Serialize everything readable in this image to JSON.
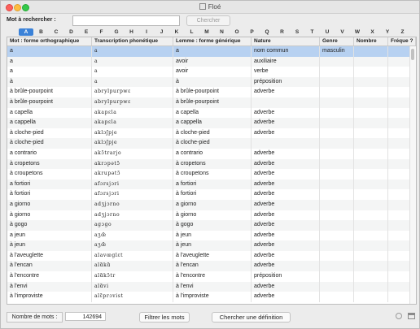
{
  "window": {
    "title": "Floé"
  },
  "search": {
    "label": "Mot à rechercher :",
    "value": "",
    "button": "Chercher"
  },
  "alphabet": [
    "A",
    "B",
    "C",
    "D",
    "E",
    "F",
    "G",
    "H",
    "I",
    "J",
    "K",
    "L",
    "M",
    "N",
    "O",
    "P",
    "Q",
    "R",
    "S",
    "T",
    "U",
    "V",
    "W",
    "X",
    "Y",
    "Z"
  ],
  "alphabet_active": "A",
  "table": {
    "columns": [
      "Mot : forme orthographique",
      "Transcription phonétique",
      "Lemme : forme générique",
      "Nature",
      "Genre",
      "Nombre",
      "Fréque ?"
    ],
    "selected_row": 0,
    "rows": [
      [
        "a",
        "a",
        "a",
        "nom commun",
        "masculin",
        "",
        ""
      ],
      [
        "a",
        "a",
        "avoir",
        "auxiliaire",
        "",
        "",
        ""
      ],
      [
        "a",
        "a",
        "avoir",
        "verbe",
        "",
        "",
        ""
      ],
      [
        "à",
        "a",
        "à",
        "préposition",
        "",
        "",
        ""
      ],
      [
        "à brûle-pourpoint",
        "abrylpurpwɛ",
        "à brûle-pourpoint",
        "adverbe",
        "",
        "",
        ""
      ],
      [
        "à brûle-pourpoint",
        "abrylpurpwɛ",
        "à brûle-pourpoint",
        "",
        "",
        "",
        ""
      ],
      [
        "a capella",
        "akapɛla",
        "a capella",
        "adverbe",
        "",
        "",
        ""
      ],
      [
        "a cappella",
        "akapɛla",
        "a cappella",
        "adverbe",
        "",
        "",
        ""
      ],
      [
        "à cloche-pied",
        "aklɔʃpje",
        "à cloche-pied",
        "adverbe",
        "",
        "",
        ""
      ],
      [
        "à cloche-pied",
        "aklɔʃpje",
        "à cloche-pied",
        "",
        "",
        "",
        ""
      ],
      [
        "a contrario",
        "akɔ̃trarjo",
        "a contrario",
        "adverbe",
        "",
        "",
        ""
      ],
      [
        "à cropetons",
        "akrɔpətɔ̃",
        "à cropetons",
        "adverbe",
        "",
        "",
        ""
      ],
      [
        "à croupetons",
        "akrupətɔ̃",
        "à croupetons",
        "adverbe",
        "",
        "",
        ""
      ],
      [
        "a fortiori",
        "afɔrsjɔri",
        "a fortiori",
        "adverbe",
        "",
        "",
        ""
      ],
      [
        "à fortiori",
        "afɔrsjɔri",
        "à fortiori",
        "adverbe",
        "",
        "",
        ""
      ],
      [
        "a giorno",
        "adʒjɔrno",
        "a giorno",
        "adverbe",
        "",
        "",
        ""
      ],
      [
        "à giorno",
        "adʒjɔrno",
        "à giorno",
        "adverbe",
        "",
        "",
        ""
      ],
      [
        "à gogo",
        "agɔgo",
        "à gogo",
        "adverbe",
        "",
        "",
        ""
      ],
      [
        "a jeun",
        "aʒœ̃",
        "à jeun",
        "adverbe",
        "",
        "",
        ""
      ],
      [
        "à jeun",
        "aʒœ̃",
        "à jeun",
        "adverbe",
        "",
        "",
        ""
      ],
      [
        "à l'aveuglette",
        "alavœglɛt",
        "à l'aveuglette",
        "adverbe",
        "",
        "",
        ""
      ],
      [
        "à l'encan",
        "alɑ̃kɑ̃",
        "à l'encan",
        "adverbe",
        "",
        "",
        ""
      ],
      [
        "à l'encontre",
        "alɑ̃kɔ̃tr",
        "à l'encontre",
        "préposition",
        "",
        "",
        ""
      ],
      [
        "à l'envi",
        "alɑ̃vi",
        "à l'envi",
        "adverbe",
        "",
        "",
        ""
      ],
      [
        "à l'improviste",
        "alɛ̃prɔvist",
        "à l'improviste",
        "adverbe",
        "",
        "",
        ""
      ]
    ]
  },
  "footer": {
    "count_label": "Nombre de mots :",
    "count_value": "142694",
    "filter_button": "Filtrer les mots",
    "definition_button": "Chercher une définition"
  }
}
